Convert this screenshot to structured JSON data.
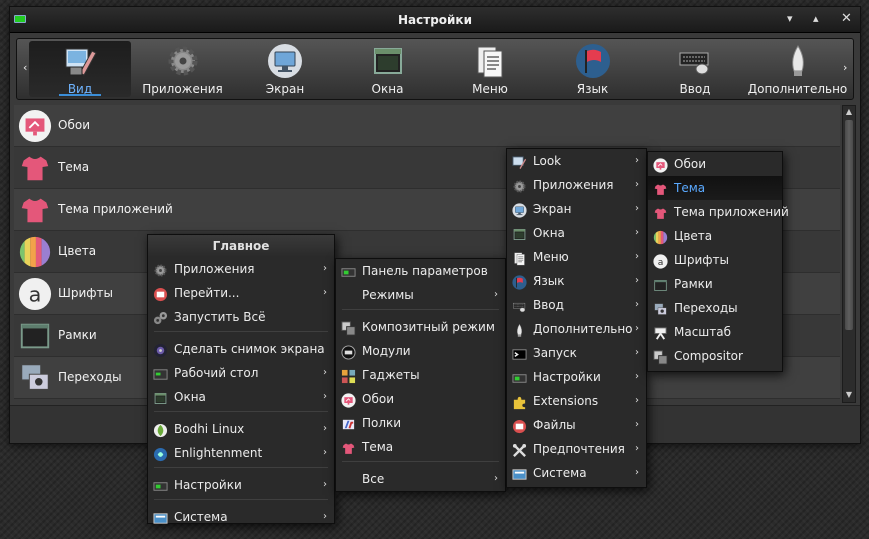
{
  "window": {
    "title": "Настройки"
  },
  "toolbar": {
    "tabs": [
      {
        "label": "Вид",
        "icon": "paint-brush-icon",
        "active": true
      },
      {
        "label": "Приложения",
        "icon": "gear-icon"
      },
      {
        "label": "Экран",
        "icon": "monitor-icon"
      },
      {
        "label": "Окна",
        "icon": "window-icon"
      },
      {
        "label": "Меню",
        "icon": "menu-list-icon"
      },
      {
        "label": "Язык",
        "icon": "flag-icon"
      },
      {
        "label": "Ввод",
        "icon": "keyboard-mouse-icon"
      },
      {
        "label": "Дополнительно",
        "icon": "bulb-icon"
      }
    ]
  },
  "list": {
    "items": [
      {
        "label": "Обои",
        "icon": "wallpaper-icon"
      },
      {
        "label": "Тема",
        "icon": "tshirt-icon"
      },
      {
        "label": "Тема приложений",
        "icon": "tshirt-icon"
      },
      {
        "label": "Цвета",
        "icon": "color-palette-icon"
      },
      {
        "label": "Шрифты",
        "icon": "font-icon"
      },
      {
        "label": "Рамки",
        "icon": "border-frame-icon"
      },
      {
        "label": "Переходы",
        "icon": "transitions-icon"
      }
    ]
  },
  "menus": {
    "main": {
      "title": "Главное",
      "items": [
        {
          "label": "Приложения",
          "icon": "gear-icon",
          "arrow": "›"
        },
        {
          "label": "Перейти...",
          "icon": "goto-icon",
          "arrow": "›"
        },
        {
          "label": "Запустить Всё",
          "icon": "cogs-icon"
        },
        {
          "label": "Сделать снимок экрана",
          "icon": "camera-icon"
        },
        {
          "label": "Рабочий стол",
          "icon": "desktop-icon",
          "arrow": "›"
        },
        {
          "label": "Окна",
          "icon": "window-icon",
          "arrow": "›"
        },
        {
          "label": "Bodhi Linux",
          "icon": "bodhi-leaf-icon",
          "arrow": "›"
        },
        {
          "label": "Enlightenment",
          "icon": "enlightenment-icon",
          "arrow": "›"
        },
        {
          "label": "Настройки",
          "icon": "settings-icon",
          "arrow": "›"
        },
        {
          "label": "Система",
          "icon": "system-icon",
          "arrow": "›"
        }
      ]
    },
    "settings": {
      "items": [
        {
          "label": "Панель параметров",
          "icon": "settings-icon"
        },
        {
          "label": "Режимы",
          "icon": "",
          "arrow": "›"
        },
        {
          "label": "Композитный режим",
          "icon": "compositor-icon"
        },
        {
          "label": "Модули",
          "icon": "modules-icon"
        },
        {
          "label": "Гаджеты",
          "icon": "gadgets-icon"
        },
        {
          "label": "Обои",
          "icon": "wallpaper-icon"
        },
        {
          "label": "Полки",
          "icon": "shelves-icon"
        },
        {
          "label": "Тема",
          "icon": "tshirt-icon"
        },
        {
          "label": "Все",
          "icon": "",
          "arrow": "›"
        }
      ]
    },
    "categories": {
      "items": [
        {
          "label": "Look",
          "icon": "look-icon",
          "arrow": "›"
        },
        {
          "label": "Приложения",
          "icon": "gear-icon",
          "arrow": "›"
        },
        {
          "label": "Экран",
          "icon": "monitor-icon",
          "arrow": "›"
        },
        {
          "label": "Окна",
          "icon": "window-icon",
          "arrow": "›"
        },
        {
          "label": "Меню",
          "icon": "menu-list-icon",
          "arrow": "›"
        },
        {
          "label": "Язык",
          "icon": "flag-icon",
          "arrow": "›"
        },
        {
          "label": "Ввод",
          "icon": "keyboard-mouse-icon",
          "arrow": "›"
        },
        {
          "label": "Дополнительно",
          "icon": "bulb-icon",
          "arrow": "›"
        },
        {
          "label": "Запуск",
          "icon": "terminal-icon",
          "arrow": "›"
        },
        {
          "label": "Настройки",
          "icon": "settings-icon",
          "arrow": "›"
        },
        {
          "label": "Extensions",
          "icon": "puzzle-icon",
          "arrow": "›"
        },
        {
          "label": "Файлы",
          "icon": "files-icon",
          "arrow": "›"
        },
        {
          "label": "Предпочтения",
          "icon": "tools-icon",
          "arrow": "›"
        },
        {
          "label": "Система",
          "icon": "system-icon",
          "arrow": "›"
        }
      ]
    },
    "look": {
      "items": [
        {
          "label": "Обои",
          "icon": "wallpaper-icon"
        },
        {
          "label": "Тема",
          "icon": "tshirt-icon",
          "selected": true
        },
        {
          "label": "Тема приложений",
          "icon": "tshirt-icon"
        },
        {
          "label": "Цвета",
          "icon": "color-palette-icon"
        },
        {
          "label": "Шрифты",
          "icon": "font-icon"
        },
        {
          "label": "Рамки",
          "icon": "border-frame-icon"
        },
        {
          "label": "Переходы",
          "icon": "transitions-icon"
        },
        {
          "label": "Масштаб",
          "icon": "scale-icon"
        },
        {
          "label": "Compositor",
          "icon": "compositor-icon"
        }
      ]
    }
  },
  "colors": {
    "accent": "#3b8ed8",
    "selected_text": "#5aa9ff",
    "pink": "#e4577a",
    "menu_bg": "#2a2a2a"
  }
}
